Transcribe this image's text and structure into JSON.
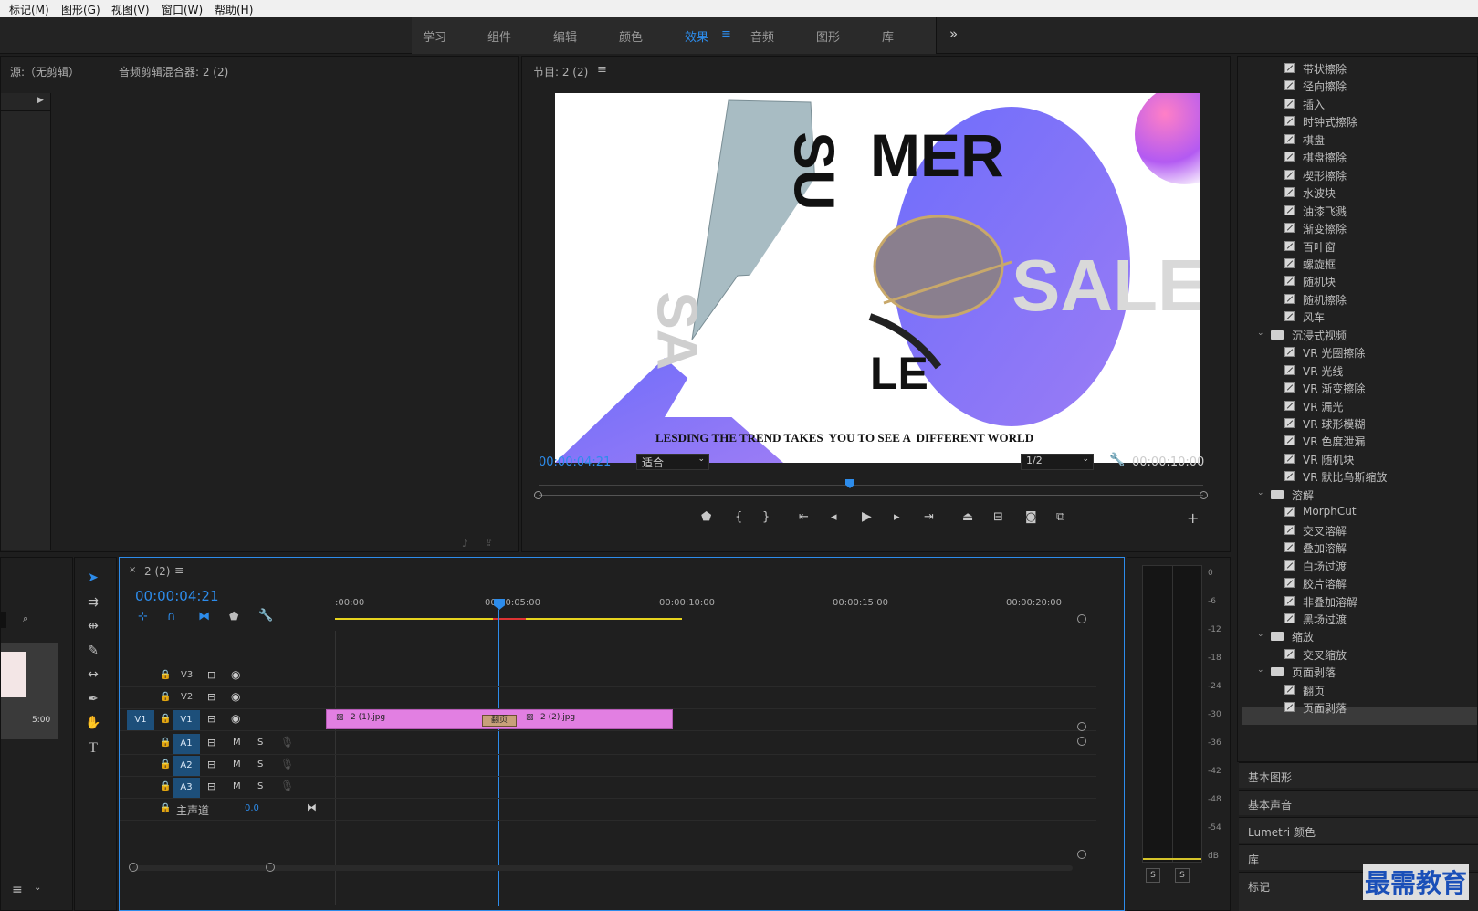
{
  "menu": [
    "标记(M)",
    "图形(G)",
    "视图(V)",
    "窗口(W)",
    "帮助(H)"
  ],
  "workspaces": [
    "学习",
    "组件",
    "编辑",
    "颜色",
    "效果",
    "音频",
    "图形",
    "库"
  ],
  "workspace_active": "效果",
  "workspace_menu_icon": "≡",
  "workspace_more": "»",
  "source_panel": {
    "tab_source": "源:（无剪辑）",
    "tab_mixer": "音频剪辑混合器: 2 (2)"
  },
  "program": {
    "title": "节目: 2 (2)",
    "timecode": "00:00:04:21",
    "fit": "适合",
    "resolution": "1/2",
    "duration": "00:00:10:00",
    "frame_text": {
      "big1": "MER",
      "big2": "SALE",
      "big3": "LE",
      "rot1": "SU",
      "rot2": "SA",
      "tagline": "LESDING THE TREND TAKES  YOU TO SEE A  DIFFERENT WORLD"
    }
  },
  "effects": {
    "items_a": [
      "带状擦除",
      "径向擦除",
      "插入",
      "时钟式擦除",
      "棋盘",
      "棋盘擦除",
      "楔形擦除",
      "水波块",
      "油漆飞溅",
      "渐变擦除",
      "百叶窗",
      "螺旋框",
      "随机块",
      "随机擦除",
      "风车"
    ],
    "folder_vr": "沉浸式视频",
    "items_vr": [
      "VR 光圈擦除",
      "VR 光线",
      "VR 渐变擦除",
      "VR 漏光",
      "VR 球形模糊",
      "VR 色度泄漏",
      "VR 随机块",
      "VR 默比乌斯缩放"
    ],
    "folder_dissolve": "溶解",
    "items_dissolve": [
      "MorphCut",
      "交叉溶解",
      "叠加溶解",
      "白场过渡",
      "胶片溶解",
      "非叠加溶解",
      "黑场过渡"
    ],
    "folder_zoom": "缩放",
    "items_zoom": [
      "交叉缩放"
    ],
    "folder_peel": "页面剥落",
    "items_peel": [
      "翻页",
      "页面剥落"
    ]
  },
  "side_sections": [
    "基本图形",
    "基本声音",
    "Lumetri 颜色",
    "库",
    "标记"
  ],
  "watermark": "最需教育",
  "project": {
    "clip_duration": "5:00"
  },
  "timeline": {
    "tab": "2 (2)",
    "timecode": "00:00:04:21",
    "ruler": [
      ":00:00",
      "00:00:05:00",
      "00:00:10:00",
      "00:00:15:00",
      "00:00:20:00"
    ],
    "tracks_video": [
      "V3",
      "V2",
      "V1"
    ],
    "tracks_audio": [
      "A1",
      "A2",
      "A3"
    ],
    "src_patch": "V1",
    "master": "主声道",
    "master_val": "0.0",
    "clip1": "2 (1).jpg",
    "clip2": "2 (2).jpg",
    "transition": "翻页",
    "mute": "M",
    "solo": "S",
    "progress_fraction": 0.488
  },
  "meter": {
    "labels": [
      "0",
      "-6",
      "-12",
      "-18",
      "-24",
      "-30",
      "-36",
      "-42",
      "-48",
      "-54",
      "dB"
    ],
    "solo_left": "S",
    "solo_right": "S"
  },
  "colors": {
    "accent": "#2d8ceb",
    "clip": "#e27fe2",
    "transition": "#c8a07a"
  }
}
